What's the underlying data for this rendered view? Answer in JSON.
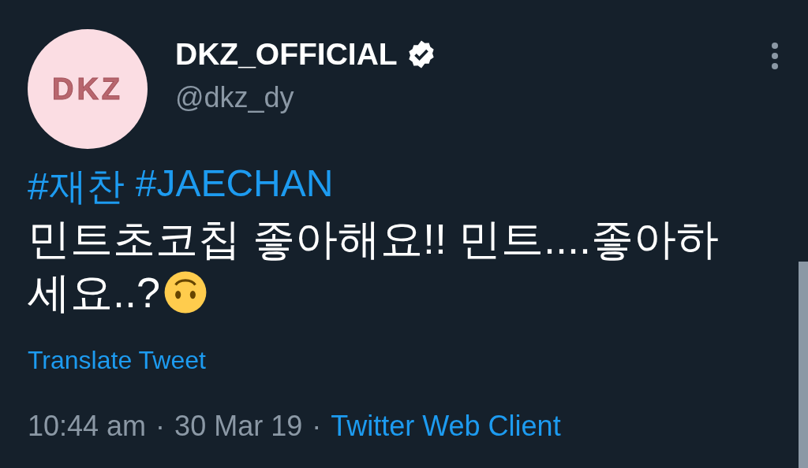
{
  "author": {
    "avatar_text": "DKZ",
    "name": "DKZ_OFFICIAL",
    "verified": true,
    "handle": "@dkz_dy"
  },
  "hashtags": [
    "#재찬",
    "#JAECHAN"
  ],
  "text_lines": [
    "민트초코칩 좋아해요!! 민트....좋아하",
    "세요..?"
  ],
  "translate_link": "Translate Tweet",
  "meta": {
    "time": "10:44 am",
    "separator_1": "·",
    "date": "30 Mar 19",
    "separator_2": "·",
    "source": "Twitter Web Client"
  }
}
